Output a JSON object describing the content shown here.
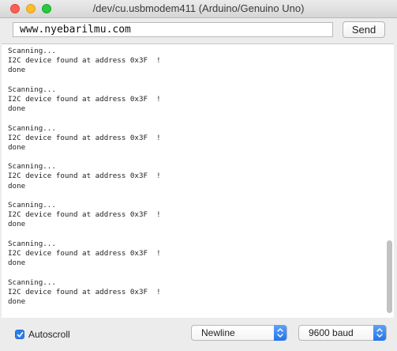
{
  "window": {
    "title": "/dev/cu.usbmodem411 (Arduino/Genuino Uno)"
  },
  "input": {
    "value": "www.nyebarilmu.com",
    "send_label": "Send"
  },
  "serial_output": [
    "Scanning...",
    "I2C device found at address 0x3F  !",
    "done",
    "",
    "Scanning...",
    "I2C device found at address 0x3F  !",
    "done",
    "",
    "Scanning...",
    "I2C device found at address 0x3F  !",
    "done",
    "",
    "Scanning...",
    "I2C device found at address 0x3F  !",
    "done",
    "",
    "Scanning...",
    "I2C device found at address 0x3F  !",
    "done",
    "",
    "Scanning...",
    "I2C device found at address 0x3F  !",
    "done",
    "",
    "Scanning...",
    "I2C device found at address 0x3F  !",
    "done"
  ],
  "bottom": {
    "autoscroll_label": "Autoscroll",
    "autoscroll_checked": true,
    "line_ending": "Newline",
    "baud_rate": "9600 baud"
  },
  "colors": {
    "accent": "#2b7cf0",
    "close": "#fc5f57",
    "minimize": "#fdbc2e",
    "maximize": "#28c840"
  }
}
